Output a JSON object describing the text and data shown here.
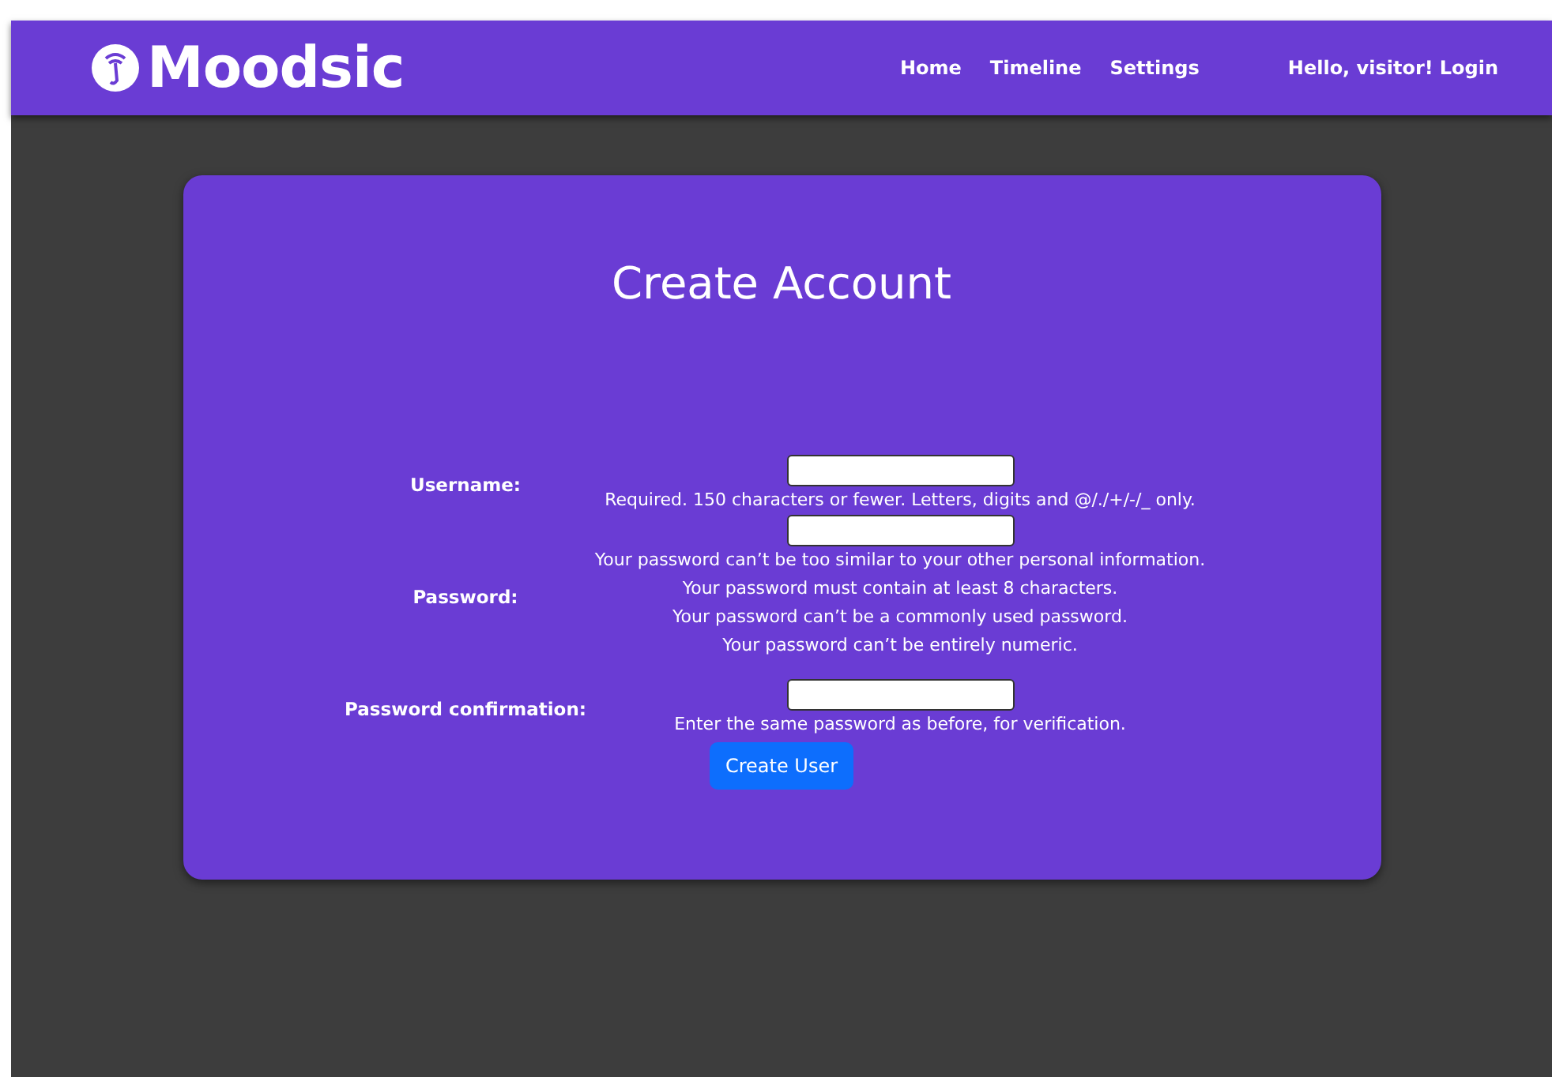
{
  "navbar": {
    "brand": "Moodsic",
    "links": [
      {
        "label": "Home"
      },
      {
        "label": "Timeline"
      },
      {
        "label": "Settings"
      }
    ],
    "greeting": "Hello, visitor!",
    "login": "Login"
  },
  "card": {
    "title": "Create Account",
    "fields": [
      {
        "label": "Username:",
        "help": [
          "Required. 150 characters or fewer. Letters, digits and @/./+/-/_ only."
        ]
      },
      {
        "label": "Password:",
        "help": [
          "Your password can’t be too similar to your other personal information.",
          "Your password must contain at least 8 characters.",
          "Your password can’t be a commonly used password.",
          "Your password can’t be entirely numeric."
        ]
      },
      {
        "label": "Password confirmation:",
        "help": [
          "Enter the same password as before, for verification."
        ]
      }
    ],
    "submit": "Create User"
  }
}
